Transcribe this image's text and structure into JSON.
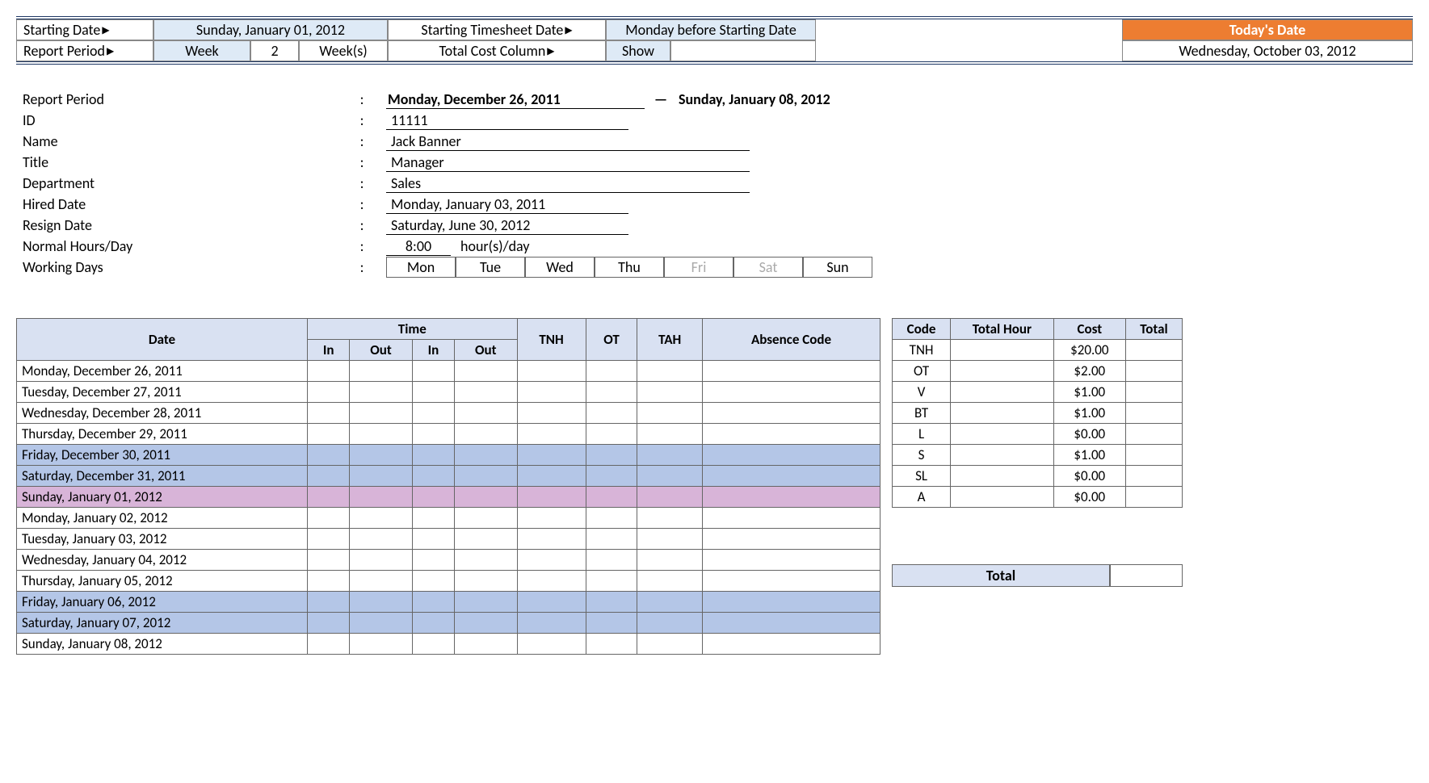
{
  "config": {
    "starting_date_label": "Starting Date",
    "starting_date_value": "Sunday, January 01, 2012",
    "report_period_label": "Report Period",
    "report_period_unit": "Week",
    "report_period_count": "2",
    "report_period_suffix": "Week(s)",
    "starting_ts_label": "Starting Timesheet Date",
    "starting_ts_value": "Monday before Starting Date",
    "total_cost_label": "Total Cost Column",
    "total_cost_value": "Show"
  },
  "today": {
    "header": "Today's Date",
    "value": "Wednesday, October 03, 2012"
  },
  "info": {
    "report_period_label": "Report Period",
    "report_period_start": "Monday, December 26, 2011",
    "report_period_end": "Sunday, January 08, 2012",
    "id_label": "ID",
    "id_value": "11111",
    "name_label": "Name",
    "name_value": "Jack Banner",
    "title_label": "Title",
    "title_value": "Manager",
    "department_label": "Department",
    "department_value": "Sales",
    "hired_label": "Hired Date",
    "hired_value": "Monday, January 03, 2011",
    "resign_label": "Resign Date",
    "resign_value": "Saturday, June 30, 2012",
    "hours_label": "Normal Hours/Day",
    "hours_value": "8:00",
    "hours_unit": "hour(s)/day",
    "working_days_label": "Working Days",
    "days": [
      "Mon",
      "Tue",
      "Wed",
      "Thu",
      "Fri",
      "Sat",
      "Sun"
    ],
    "days_off": [
      false,
      false,
      false,
      false,
      true,
      true,
      false
    ]
  },
  "timesheet": {
    "headers": {
      "date": "Date",
      "time": "Time",
      "in": "In",
      "out": "Out",
      "tnh": "TNH",
      "ot": "OT",
      "tah": "TAH",
      "absence": "Absence Code"
    },
    "rows": [
      {
        "date": "Monday, December 26, 2011",
        "cls": ""
      },
      {
        "date": "Tuesday, December 27, 2011",
        "cls": ""
      },
      {
        "date": "Wednesday, December 28, 2011",
        "cls": ""
      },
      {
        "date": "Thursday, December 29, 2011",
        "cls": ""
      },
      {
        "date": "Friday, December 30, 2011",
        "cls": "weekend"
      },
      {
        "date": "Saturday, December 31, 2011",
        "cls": "weekend"
      },
      {
        "date": "Sunday, January 01, 2012",
        "cls": "sunday-hl"
      },
      {
        "date": "Monday, January 02, 2012",
        "cls": ""
      },
      {
        "date": "Tuesday, January 03, 2012",
        "cls": ""
      },
      {
        "date": "Wednesday, January 04, 2012",
        "cls": ""
      },
      {
        "date": "Thursday, January 05, 2012",
        "cls": ""
      },
      {
        "date": "Friday, January 06, 2012",
        "cls": "weekend"
      },
      {
        "date": "Saturday, January 07, 2012",
        "cls": "weekend"
      },
      {
        "date": "Sunday, January 08, 2012",
        "cls": ""
      }
    ]
  },
  "codes": {
    "headers": {
      "code": "Code",
      "total_hour": "Total Hour",
      "cost": "Cost",
      "total": "Total"
    },
    "rows": [
      {
        "code": "TNH",
        "hour": "",
        "cost": "$20.00",
        "total": ""
      },
      {
        "code": "OT",
        "hour": "",
        "cost": "$2.00",
        "total": ""
      },
      {
        "code": "V",
        "hour": "",
        "cost": "$1.00",
        "total": ""
      },
      {
        "code": "BT",
        "hour": "",
        "cost": "$1.00",
        "total": ""
      },
      {
        "code": "L",
        "hour": "",
        "cost": "$0.00",
        "total": ""
      },
      {
        "code": "S",
        "hour": "",
        "cost": "$1.00",
        "total": ""
      },
      {
        "code": "SL",
        "hour": "",
        "cost": "$0.00",
        "total": ""
      },
      {
        "code": "A",
        "hour": "",
        "cost": "$0.00",
        "total": ""
      }
    ],
    "grand_total_label": "Total",
    "grand_total_value": ""
  }
}
